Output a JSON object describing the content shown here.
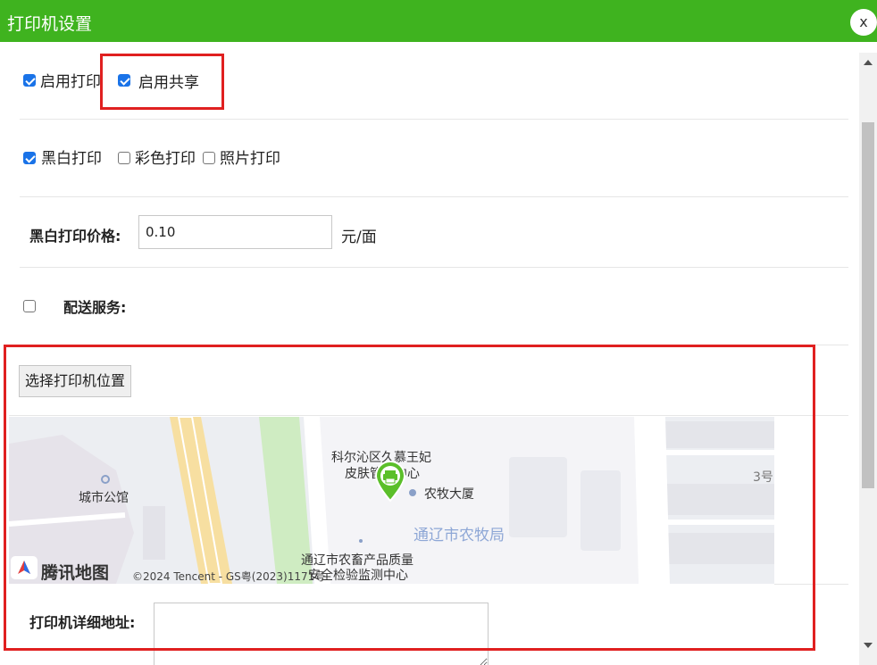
{
  "dialog": {
    "title": "打印机设置",
    "close_label": "x"
  },
  "share": {
    "enable_print_label": "启用打印",
    "enable_print_checked": true,
    "enable_share_label": "启用共享",
    "enable_share_checked": true
  },
  "print_modes": {
    "bw_label": "黑白打印",
    "bw_checked": true,
    "color_label": "彩色打印",
    "color_checked": false,
    "photo_label": "照片打印",
    "photo_checked": false
  },
  "price": {
    "label": "黑白打印价格:",
    "value": "0.10",
    "unit": "元/面"
  },
  "delivery": {
    "label": "配送服务:",
    "checked": false
  },
  "location": {
    "select_button": "选择打印机位置",
    "address_label": "打印机详细地址:",
    "address_value": ""
  },
  "map": {
    "pois": [
      "科尔沁区久慕王妃",
      "皮肤管理中心",
      "农牧大厦",
      "城市公馆",
      "通辽市农牧局",
      "通辽市农畜产品质量",
      "安全检验监测中心",
      "3号"
    ],
    "logo_text": "腾讯地图",
    "copyright": "©2024 Tencent - GS粤(2023)1171号",
    "marker_color": "#5bbf2a"
  },
  "colors": {
    "titlebar": "#3fb31f",
    "highlight": "#e02020",
    "checkbox": "#1a73e8"
  }
}
